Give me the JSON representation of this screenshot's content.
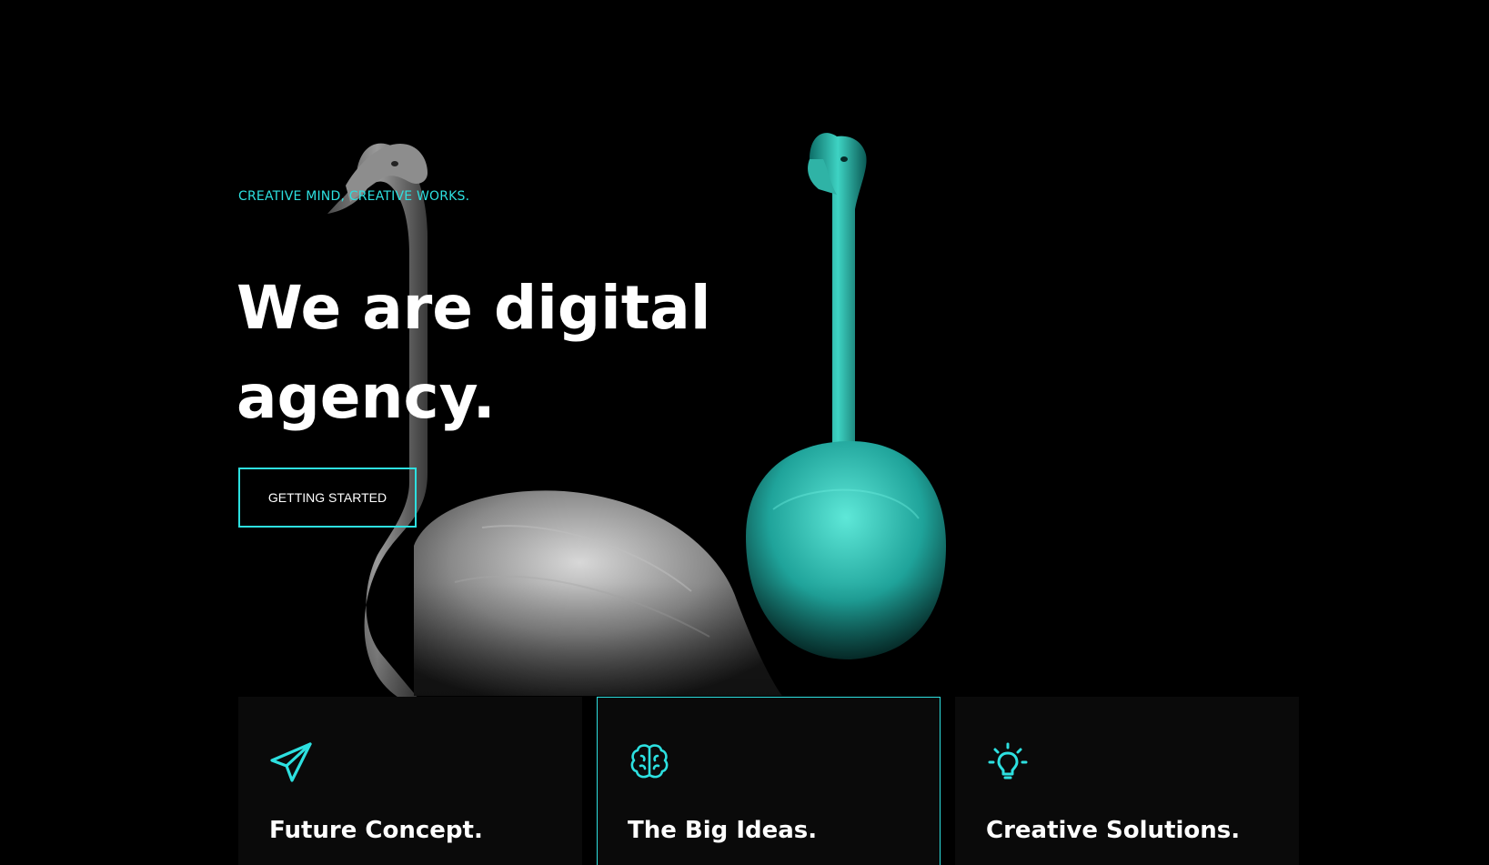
{
  "hero": {
    "tagline": "CREATIVE MIND, CREATIVE WORKS.",
    "headline": "We are digital agency.",
    "cta_label": "GETTING STARTED"
  },
  "features": [
    {
      "title": "Future Concept.",
      "icon": "paper-plane-icon"
    },
    {
      "title": "The Big Ideas.",
      "icon": "brain-icon"
    },
    {
      "title": "Creative Solutions.",
      "icon": "lightbulb-icon"
    }
  ],
  "colors": {
    "background": "#000000",
    "accent": "#2de0e0",
    "text": "#ffffff",
    "card": "#0a0a0a"
  }
}
